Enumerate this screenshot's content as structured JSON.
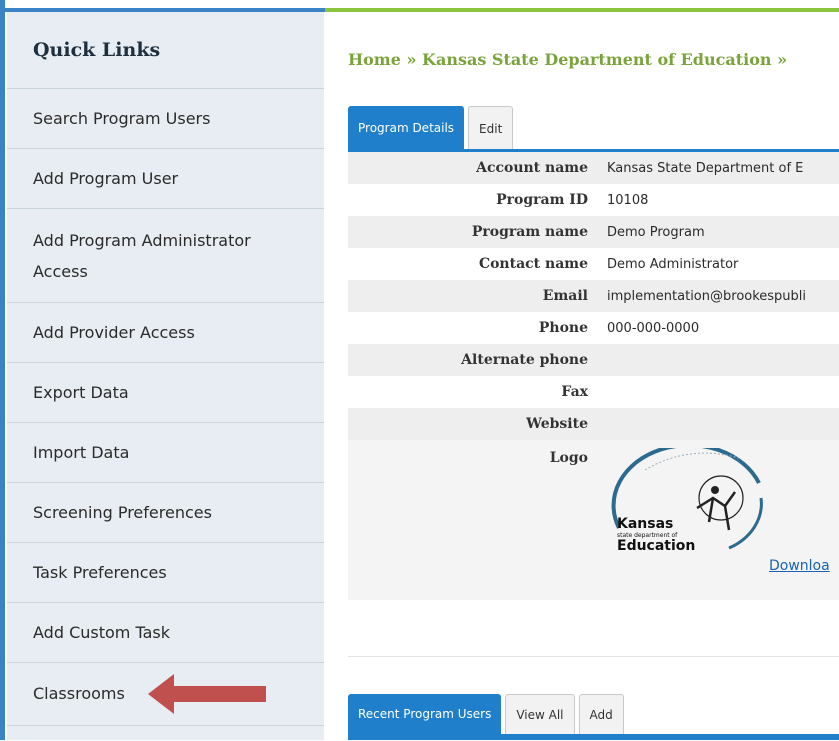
{
  "sidebar": {
    "title": "Quick Links",
    "items": [
      {
        "label": "Search Program Users"
      },
      {
        "label": "Add Program User"
      },
      {
        "label": "Add Program Administrator Access"
      },
      {
        "label": "Add Provider Access"
      },
      {
        "label": "Export Data"
      },
      {
        "label": "Import Data"
      },
      {
        "label": "Screening Preferences"
      },
      {
        "label": "Task Preferences"
      },
      {
        "label": "Add Custom Task"
      },
      {
        "label": "Classrooms"
      }
    ],
    "arrow_icon": "left-arrow-icon",
    "arrow_color": "#c0504d"
  },
  "breadcrumb": "Home » Kansas State Department of Education »",
  "details_tabs": [
    "Program Details",
    "Edit"
  ],
  "details": {
    "account_name": {
      "label": "Account name",
      "value": "Kansas State Department of E"
    },
    "program_id": {
      "label": "Program ID",
      "value": "10108"
    },
    "program_name": {
      "label": "Program name",
      "value": "Demo Program"
    },
    "contact_name": {
      "label": "Contact name",
      "value": "Demo Administrator"
    },
    "email": {
      "label": "Email",
      "value": "implementation@brookespubli"
    },
    "phone": {
      "label": "Phone",
      "value": "000-000-0000"
    },
    "alternate_phone": {
      "label": "Alternate phone",
      "value": ""
    },
    "fax": {
      "label": "Fax",
      "value": ""
    },
    "website": {
      "label": "Website",
      "value": ""
    },
    "logo": {
      "label": "Logo",
      "logo_line1": "Kansas",
      "logo_line2": "state department of",
      "logo_line3": "Education",
      "download": "Downloa"
    }
  },
  "recent_tabs": [
    "Recent Program Users",
    "View All",
    "Add"
  ],
  "colors": {
    "accent_blue": "#1f7fcb",
    "accent_green": "#8bc43f",
    "breadcrumb_green": "#7aa33b"
  }
}
